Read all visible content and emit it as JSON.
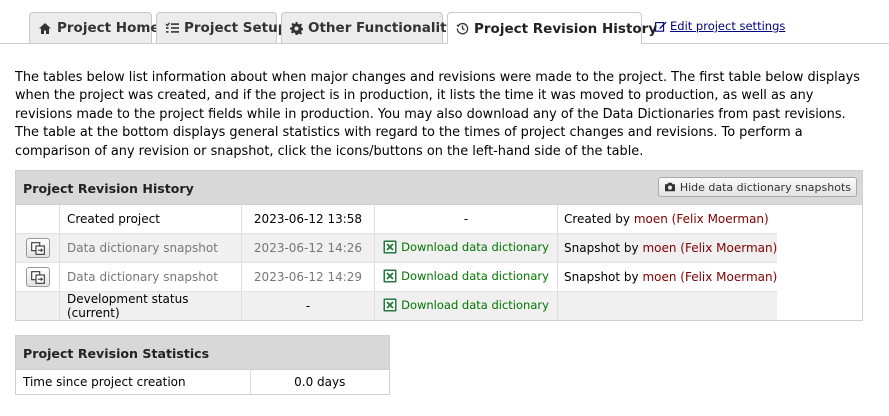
{
  "tabs": [
    {
      "label": "Project Home",
      "icon": "home-icon"
    },
    {
      "label": "Project Setup",
      "icon": "list-icon"
    },
    {
      "label": "Other Functionality",
      "icon": "gear-icon"
    },
    {
      "label": "Project Revision History",
      "icon": "history-icon",
      "active": true
    }
  ],
  "edit_link": "Edit project settings",
  "intro": "The tables below list information about when major changes and revisions were made to the project. The first table below displays when the project was created, and if the project is in production, it lists the time it was moved to production, as well as any revisions made to the project fields while in production. You may also download any of the Data Dictionaries from past revisions. The table at the bottom displays general statistics with regard to the times of project changes and revisions. To perform a comparison of any revision or snapshot, click the icons/buttons on the left-hand side of the table.",
  "revision_history": {
    "title": "Project Revision History",
    "hide_button": "Hide data dictionary snapshots",
    "rows": [
      {
        "desc": "Created project",
        "time": "2023-06-12 13:58",
        "download": "-",
        "by_prefix": "Created by ",
        "user": "moen (Felix Moerman)"
      },
      {
        "desc": "Data dictionary snapshot",
        "time": "2023-06-12 14:26",
        "download": "Download data dictionary",
        "by_prefix": "Snapshot by ",
        "user": "moen (Felix Moerman)"
      },
      {
        "desc": "Data dictionary snapshot",
        "time": "2023-06-12 14:29",
        "download": "Download data dictionary",
        "by_prefix": "Snapshot by ",
        "user": "moen (Felix Moerman)"
      },
      {
        "desc": "Development status (current)",
        "time": "-",
        "download": "Download data dictionary",
        "by_prefix": "",
        "user": ""
      }
    ]
  },
  "revision_stats": {
    "title": "Project Revision Statistics",
    "label": "Time since project creation",
    "value": "0.0 days"
  },
  "colors": {
    "user_link": "#800000",
    "download_link": "#007500",
    "edit_link": "#000080"
  }
}
